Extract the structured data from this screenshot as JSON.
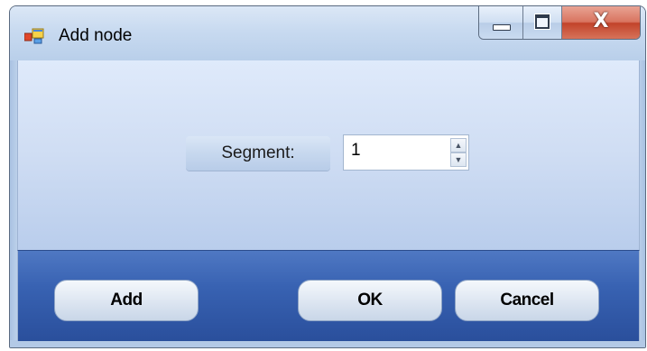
{
  "window": {
    "title": "Add node",
    "icon": "application-icon",
    "controls": {
      "minimize_icon": "minimize-icon",
      "maximize_icon": "maximize-icon",
      "close_label": "X"
    }
  },
  "form": {
    "segment_label": "Segment:",
    "segment_value": "1"
  },
  "buttons": {
    "add_label": "Add",
    "ok_label": "OK",
    "cancel_label": "Cancel"
  },
  "colors": {
    "footer_band": "#3862b2",
    "close_button": "#c2432a"
  }
}
